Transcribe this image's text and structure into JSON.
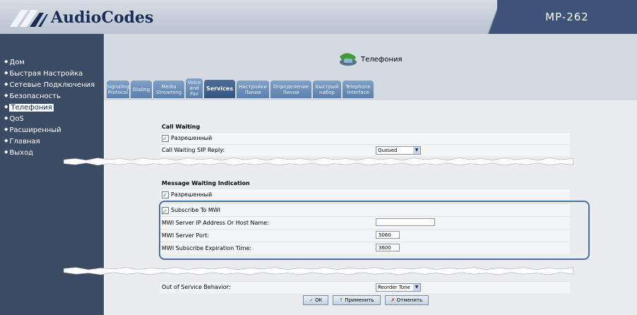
{
  "header": {
    "brand": "AudioCodes",
    "product": "MP-262"
  },
  "nav": [
    {
      "label": "Дом"
    },
    {
      "label": "Быстрая Настройка"
    },
    {
      "label": "Сетевые Подключения"
    },
    {
      "label": "Безопасность"
    },
    {
      "label": "Телефония"
    },
    {
      "label": "QoS"
    },
    {
      "label": "Расширенный"
    },
    {
      "label": "Главная"
    },
    {
      "label": "Выход"
    }
  ],
  "page": {
    "title": "Телефония"
  },
  "tabs": [
    {
      "line1": "Signaling",
      "line2": "Protocol",
      "line3": ""
    },
    {
      "line1": "Dialing",
      "line2": "",
      "line3": ""
    },
    {
      "line1": "Media",
      "line2": "Streaming",
      "line3": ""
    },
    {
      "line1": "Voice",
      "line2": "and",
      "line3": "Fax"
    },
    {
      "line1": "Services",
      "line2": "",
      "line3": ""
    },
    {
      "line1": "Настройки",
      "line2": "Линии",
      "line3": ""
    },
    {
      "line1": "Определение",
      "line2": "Линии",
      "line3": ""
    },
    {
      "line1": "Быстрый",
      "line2": "набор",
      "line3": ""
    },
    {
      "line1": "Telephone",
      "line2": "Interface",
      "line3": ""
    }
  ],
  "call_waiting": {
    "title": "Call Waiting",
    "enabled_label": "Разрешенный",
    "sip_reply_label": "Call Waiting SIP Reply:",
    "sip_reply_value": "Queued"
  },
  "mwi": {
    "title": "Message Waiting Indication",
    "enabled_label": "Разрешенный",
    "subscribe_label": "Subscribe To MWI",
    "server_label": "MWI Server IP Address Or Host Name:",
    "server_value": "",
    "port_label": "MWI Server Port:",
    "port_value": "5060",
    "expiration_label": "MWI Subscribe Expiration Time:",
    "expiration_value": "3600"
  },
  "out_of_service": {
    "label": "Out of Service Behavior:",
    "value": "Reorder Tone"
  },
  "buttons": {
    "ok": "OK",
    "apply": "Применить",
    "cancel": "Отменить"
  },
  "colors": {
    "sidebar": "#3b4b64",
    "header_dark": "#3e5379",
    "accent": "#4a6fa5",
    "check": "#2e8a22"
  }
}
